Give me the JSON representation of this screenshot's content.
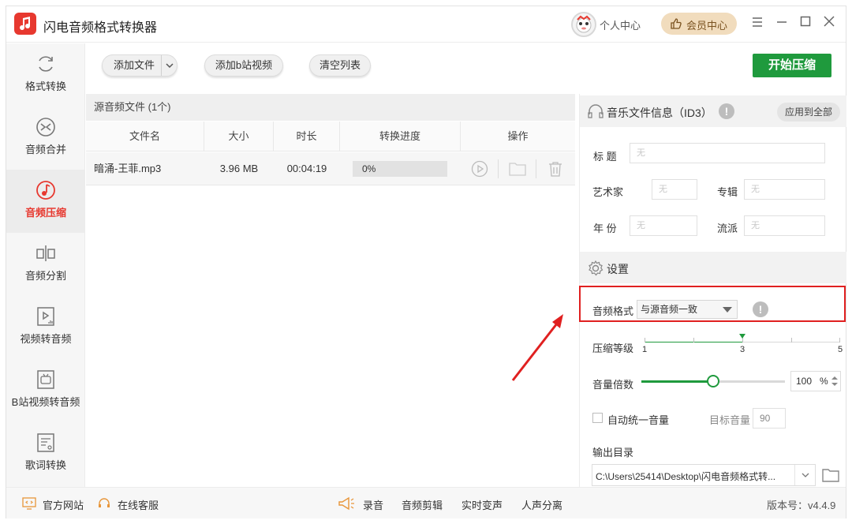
{
  "app": {
    "title": "闪电音频格式转换器",
    "user_center": "个人中心",
    "vip_center": "会员中心",
    "accent": "#1f9a3d",
    "brand": "#e7382f"
  },
  "window_controls": [
    "menu-icon",
    "minimize-icon",
    "maximize-icon",
    "close-icon"
  ],
  "sidebar": {
    "items": [
      {
        "label": "格式转换",
        "icon": "format-convert-icon",
        "active": false
      },
      {
        "label": "音频合并",
        "icon": "merge-icon",
        "active": false
      },
      {
        "label": "音频压缩",
        "icon": "compress-icon",
        "active": true
      },
      {
        "label": "音频分割",
        "icon": "split-icon",
        "active": false
      },
      {
        "label": "视频转音频",
        "icon": "video-to-audio-icon",
        "active": false
      },
      {
        "label": "B站视频转音频",
        "icon": "bilibili-icon",
        "active": false
      },
      {
        "label": "歌词转换",
        "icon": "lyrics-icon",
        "active": false
      }
    ]
  },
  "toolbar": {
    "add_file": "添加文件",
    "add_bilibili": "添加b站视频",
    "clear_list": "清空列表",
    "start": "开始压缩"
  },
  "filelist": {
    "header": "源音频文件 (1个)",
    "columns": [
      "文件名",
      "大小",
      "时长",
      "转换进度",
      "操作"
    ],
    "rows": [
      {
        "name": "暗涌-王菲.mp3",
        "size": "3.96 MB",
        "duration": "00:04:19",
        "progress": "0%",
        "progress_value": 0
      }
    ]
  },
  "id3": {
    "title": "音乐文件信息（ID3）",
    "apply_all": "应用到全部",
    "fields": {
      "title_label": "标 题",
      "artist_label": "艺术家",
      "album_label": "专辑",
      "year_label": "年 份",
      "genre_label": "流派",
      "placeholder": "无"
    }
  },
  "settings": {
    "title": "设置",
    "format_label": "音频格式",
    "format_value": "与源音频一致",
    "compress_label": "压缩等级",
    "compress_min": "1",
    "compress_value": "3",
    "compress_max": "5",
    "compress_level": 3,
    "volume_label": "音量倍数",
    "volume_value": "100",
    "volume_unit": "%",
    "auto_volume_label": "自动统一音量",
    "target_volume_label": "目标音量",
    "target_volume_value": "90",
    "output_label": "输出目录",
    "output_path": "C:\\Users\\25414\\Desktop\\闪电音频格式转..."
  },
  "statusbar": {
    "website": "官方网站",
    "support": "在线客服",
    "record": "录音",
    "edit": "音频剪辑",
    "voice_change": "实时变声",
    "vocal_split": "人声分离",
    "version": "版本号：v4.4.9"
  }
}
